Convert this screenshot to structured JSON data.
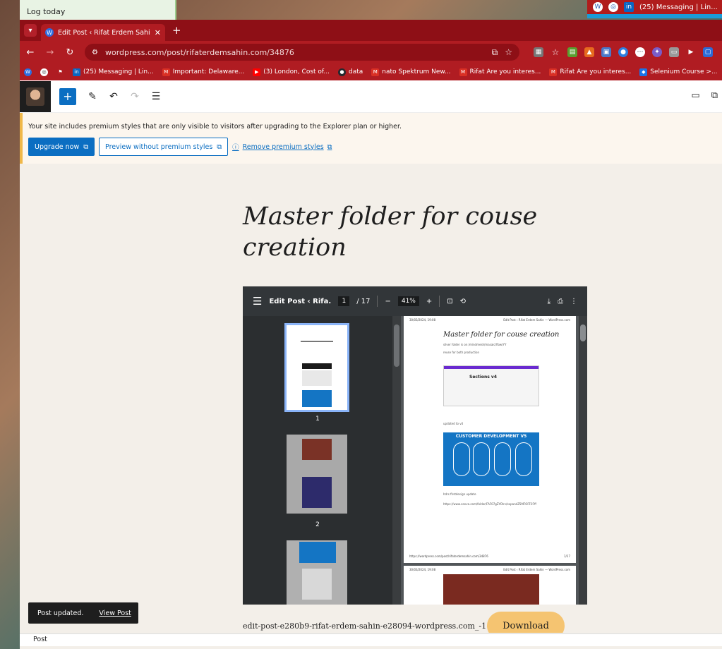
{
  "background": {
    "left_window_text": "Log today",
    "right_tab_text": "(25) Messaging | Lin..."
  },
  "browser": {
    "tab_title": "Edit Post ‹ Rifat Erdem Sahin —",
    "url": "wordpress.com/post/rifaterdemsahin.com/34876",
    "bookmarks": [
      {
        "label": "(25) Messaging | Lin...",
        "icon": "linkedin-icon",
        "color": "#0a66c2",
        "glyph": "in"
      },
      {
        "label": "Important: Delaware...",
        "icon": "gmail-icon",
        "color": "#d93025",
        "glyph": "M"
      },
      {
        "label": "(3) London, Cost of...",
        "icon": "youtube-icon",
        "color": "#ff0000",
        "glyph": "▶"
      },
      {
        "label": "data",
        "icon": "github-icon",
        "color": "#24292f",
        "glyph": "●"
      },
      {
        "label": "nato Spektrum New...",
        "icon": "gmail-icon",
        "color": "#d93025",
        "glyph": "M"
      },
      {
        "label": "Rifat Are you interes...",
        "icon": "gmail-icon",
        "color": "#d93025",
        "glyph": "M"
      },
      {
        "label": "Rifat Are you interes...",
        "icon": "gmail-icon",
        "color": "#d93025",
        "glyph": "M"
      },
      {
        "label": "Selenium Course >...",
        "icon": "shield-icon",
        "color": "#1a73e8",
        "glyph": "◆"
      }
    ]
  },
  "notice": {
    "text": "Your site includes premium styles that are only visible to visitors after upgrading to the Explorer plan or higher.",
    "upgrade_label": "Upgrade now",
    "preview_label": "Preview without premium styles",
    "remove_label": "Remove premium styles"
  },
  "post": {
    "title": "Master folder for couse creation"
  },
  "pdf": {
    "doc_title": "Edit Post ‹ Rifa...",
    "page_current": "1",
    "page_total": "/ 17",
    "zoom": "41%",
    "thumb_numbers": [
      "1",
      "2"
    ],
    "page1": {
      "header_left": "30/03/2024, 19:08",
      "header_right": "Edit Post ‹ Rifat Erdem Sahin — WordPress.com",
      "title": "Master folder for couse creation",
      "line1": "silver folder is on /mindmesh/masaic/flow/YY",
      "line2": "reuse for both production",
      "shot_heading": "Sections v4",
      "line3": "updated to v4",
      "cd_title": "CUSTOMER DEVELOPMENT V5",
      "line4": "hdrs firstdesign update",
      "line5": "https://www.canva.com/folder/FAF07gZYOlrv/expandZ5MFOFF07ff",
      "footer_left": "https://wordpress.com/post/rifaterdemsahin.com/34876",
      "footer_right": "1/17"
    },
    "page2": {
      "header_left": "30/03/2024, 19:08",
      "header_right": "Edit Post ‹ Rifat Erdem Sahin — WordPress.com"
    }
  },
  "caption": "edit-post-e280b9-rifat-erdem-sahin-e28094-wordpress.com_-1",
  "download_label": "Download",
  "snackbar": {
    "message": "Post updated.",
    "link": "View Post"
  },
  "footer_label": "Post"
}
